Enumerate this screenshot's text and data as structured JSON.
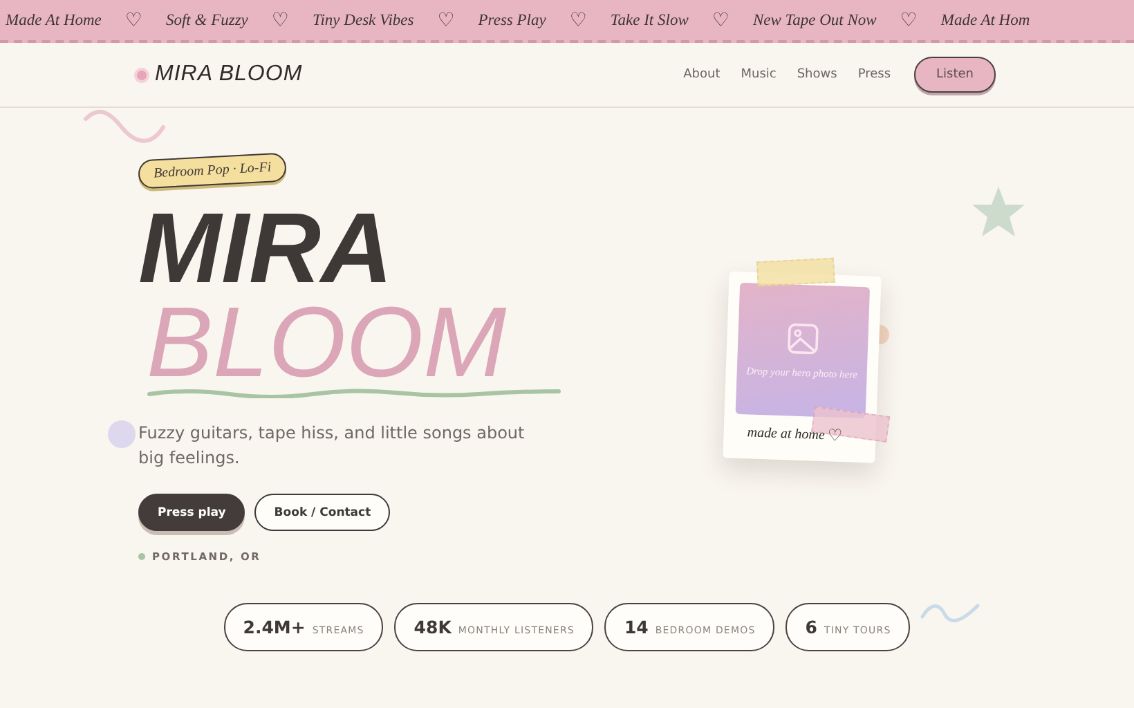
{
  "ticker": [
    {
      "kind": "label",
      "text": "Made At Home"
    },
    {
      "kind": "heart",
      "text": "♡"
    },
    {
      "kind": "label",
      "text": "Soft & Fuzzy"
    },
    {
      "kind": "heart",
      "text": "♡"
    },
    {
      "kind": "label",
      "text": "Tiny Desk Vibes"
    },
    {
      "kind": "heart",
      "text": "♡"
    },
    {
      "kind": "label",
      "text": "Press Play"
    },
    {
      "kind": "heart",
      "text": "♡"
    },
    {
      "kind": "label",
      "text": "Take It Slow"
    },
    {
      "kind": "heart",
      "text": "♡"
    },
    {
      "kind": "label",
      "text": "New Tape Out Now"
    },
    {
      "kind": "heart",
      "text": "♡"
    },
    {
      "kind": "label",
      "text": "Made At Hom"
    }
  ],
  "header": {
    "logo": "MIRA BLOOM",
    "nav": [
      "About",
      "Music",
      "Shows",
      "Press"
    ],
    "cta": "Listen"
  },
  "hero": {
    "tag": "Bedroom Pop · Lo-Fi",
    "title_line_1": "MIRA",
    "title_line_2": "BLOOM",
    "tagline": "Fuzzy guitars, tape hiss, and little songs about big feelings.",
    "buttons": [
      {
        "kind": "primary",
        "label": "Press play"
      },
      {
        "kind": "outline",
        "label": "Book / Contact"
      }
    ],
    "location": "PORTLAND, OR"
  },
  "polaroid": {
    "placeholder": "Drop your hero photo here",
    "caption": "made at home",
    "caption_icon": "♡"
  },
  "stats": [
    {
      "value": "2.4M+",
      "label": "STREAMS"
    },
    {
      "value": "48K",
      "label": "MONTHLY LISTENERS"
    },
    {
      "value": "14",
      "label": "BEDROOM DEMOS"
    },
    {
      "value": "6",
      "label": "TINY TOURS"
    }
  ]
}
